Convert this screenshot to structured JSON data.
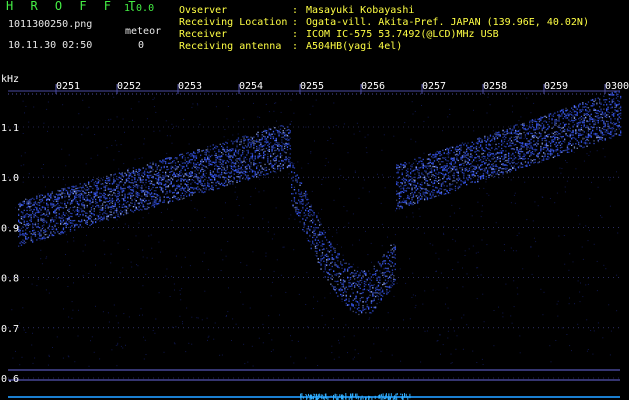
{
  "header": {
    "app_title": "H R O F F T",
    "version": "1.0.0",
    "filename": "1011300250.png",
    "datetime": "10.11.30 02:50",
    "meteor_label": "meteor",
    "meteor_count": "0"
  },
  "info": [
    {
      "label": "Ovserver",
      "value": "Masayuki Kobayashi"
    },
    {
      "label": "Receiving Location",
      "value": "Ogata-vill. Akita-Pref. JAPAN (139.96E, 40.02N)"
    },
    {
      "label": "Receiver",
      "value": "ICOM IC-575 53.7492(@LCD)MHz USB"
    },
    {
      "label": "Receiving antenna",
      "value": "A504HB(yagi 4el)"
    }
  ],
  "separator": ":",
  "plot": {
    "y_unit": "kHz",
    "x_ticks": [
      "0251",
      "0252",
      "0253",
      "0254",
      "0255",
      "0256",
      "0257",
      "0258",
      "0259",
      "0300"
    ],
    "y_ticks": [
      "1.1",
      "1.0",
      "0.9",
      "0.8",
      "0.7",
      "0.6"
    ],
    "colors": {
      "grid": "#4a4aa0",
      "signal": "#3a5cff",
      "signal_bright": "#9ab0ff",
      "axis_text": "#ffffff",
      "info_text": "#ffff44",
      "title_text": "#44ee44"
    }
  }
}
